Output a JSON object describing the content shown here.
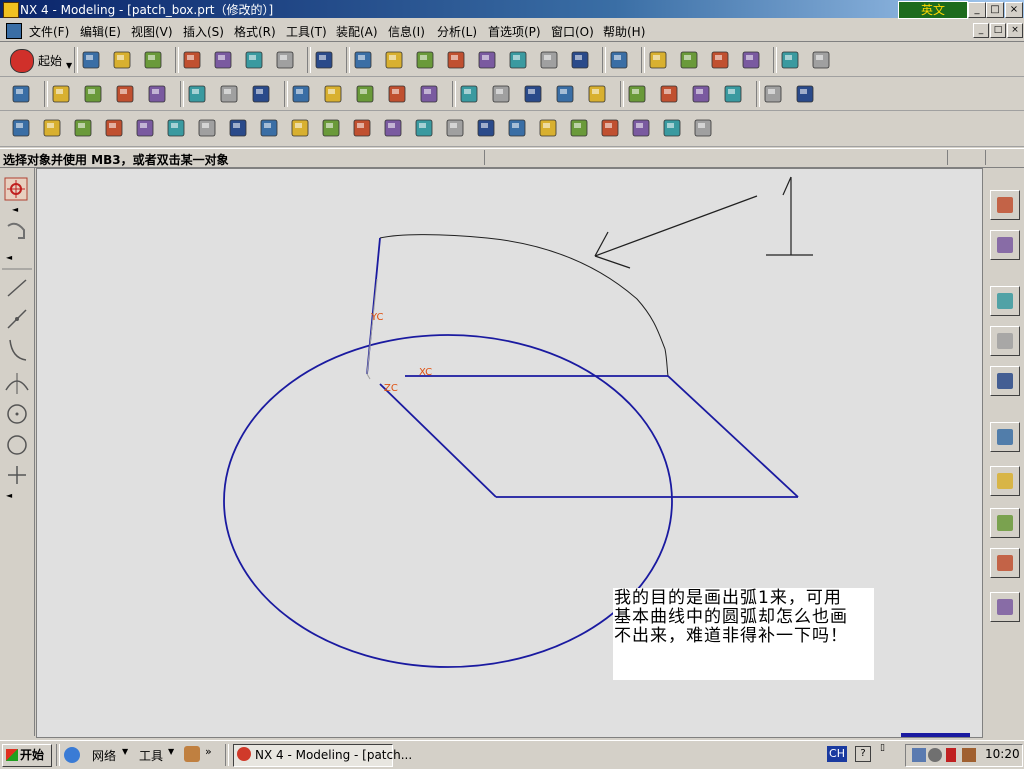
{
  "window": {
    "title": "NX 4 - Modeling - [patch_box.prt（修改的）]",
    "ime_label": "英文"
  },
  "window_controls": {
    "minimize": "_",
    "maximize": "□",
    "close": "×"
  },
  "menu": {
    "items": [
      "文件(F)",
      "编辑(E)",
      "视图(V)",
      "插入(S)",
      "格式(R)",
      "工具(T)",
      "装配(A)",
      "信息(I)",
      "分析(L)",
      "首选项(P)",
      "窗口(O)",
      "帮助(H)"
    ]
  },
  "toolbar": {
    "start_label": "起始",
    "row1_icons": [
      "new-file-icon",
      "open-folder-icon",
      "save-icon",
      "cut-icon",
      "copy-icon",
      "paste-icon",
      "undo-icon",
      "command-finder-icon",
      "fit-view-icon",
      "zoom-area-icon",
      "zoom-icon",
      "pan-icon",
      "rotate-icon",
      "snap-view-icon",
      "orient-view-icon",
      "shaded-cube-icon",
      "render-style-icon",
      "selection-filter-icon",
      "point-constructor-icon",
      "color-palette-icon",
      "layer-settings-icon",
      "measure-distance-icon",
      "ruler-icon"
    ],
    "row2_icons": [
      "sketch-icon",
      "datum-plane-icon",
      "extrude-icon",
      "revolve-icon",
      "hole-icon",
      "boolean-icon",
      "edge-blend-icon",
      "chamfer-icon",
      "shell-icon",
      "draft-icon",
      "offset-icon",
      "trim-body-icon",
      "block-icon",
      "rectangle-icon",
      "line-icon",
      "arc-icon",
      "profile-icon",
      "fillet-curve-icon",
      "surface-mesh-icon",
      "through-curves-icon",
      "swept-icon",
      "studio-surface-icon",
      "law-extension-icon",
      "bounded-plane-icon"
    ],
    "row3_icons": [
      "part-navigator-icon",
      "wcs-icon",
      "csys-icon",
      "cube-view-icon",
      "section-icon",
      "mold-icon",
      "tools-icon",
      "layers-icon",
      "drawing-icon",
      "dimension-icon",
      "gdt-icon",
      "annotation-icon",
      "weld-icon",
      "feature-control-icon",
      "inspection-icon",
      "table-icon",
      "assembly-icon",
      "export-icon",
      "grid-icon",
      "display-icon",
      "globe-icon",
      "eye-icon",
      "cylinder-icon"
    ]
  },
  "cue_line": "选择对象并使用 MB3，或者双击某一对象",
  "left_panel": {
    "tools": [
      "snap-point-icon",
      "curve-tool-icon",
      "line-tool-icon",
      "line-2-tool-icon",
      "arc-tool-icon",
      "intersection-tool-icon",
      "circle-center-icon",
      "circle-tool-icon",
      "point-tool-icon"
    ]
  },
  "right_panel": {
    "tabs": [
      "assembly-navigator-icon",
      "part-navigator-icon",
      "web-browser-icon",
      "training-icon",
      "help-icon",
      "history-icon",
      "palette-icon",
      "process-studio-icon",
      "roles-icon",
      "system-materials-icon"
    ]
  },
  "canvas": {
    "wcs_labels": {
      "yc": "YC",
      "xc": "XC",
      "zc": "ZC"
    },
    "annotation_number": "1",
    "note_lines": [
      "我的目的是画出弧1来，可用",
      "基本曲线中的圆弧却怎么也画",
      "不出来，难道非得补一下吗！"
    ],
    "curve_color": "#1a1aa0",
    "label_color": "#e05010"
  },
  "taskbar": {
    "start_label": "开始",
    "network_label": "网络",
    "tools_label": "工具",
    "task_label": "NX 4 - Modeling - [patch...",
    "ime_code": "CH",
    "clock": "10:20"
  }
}
